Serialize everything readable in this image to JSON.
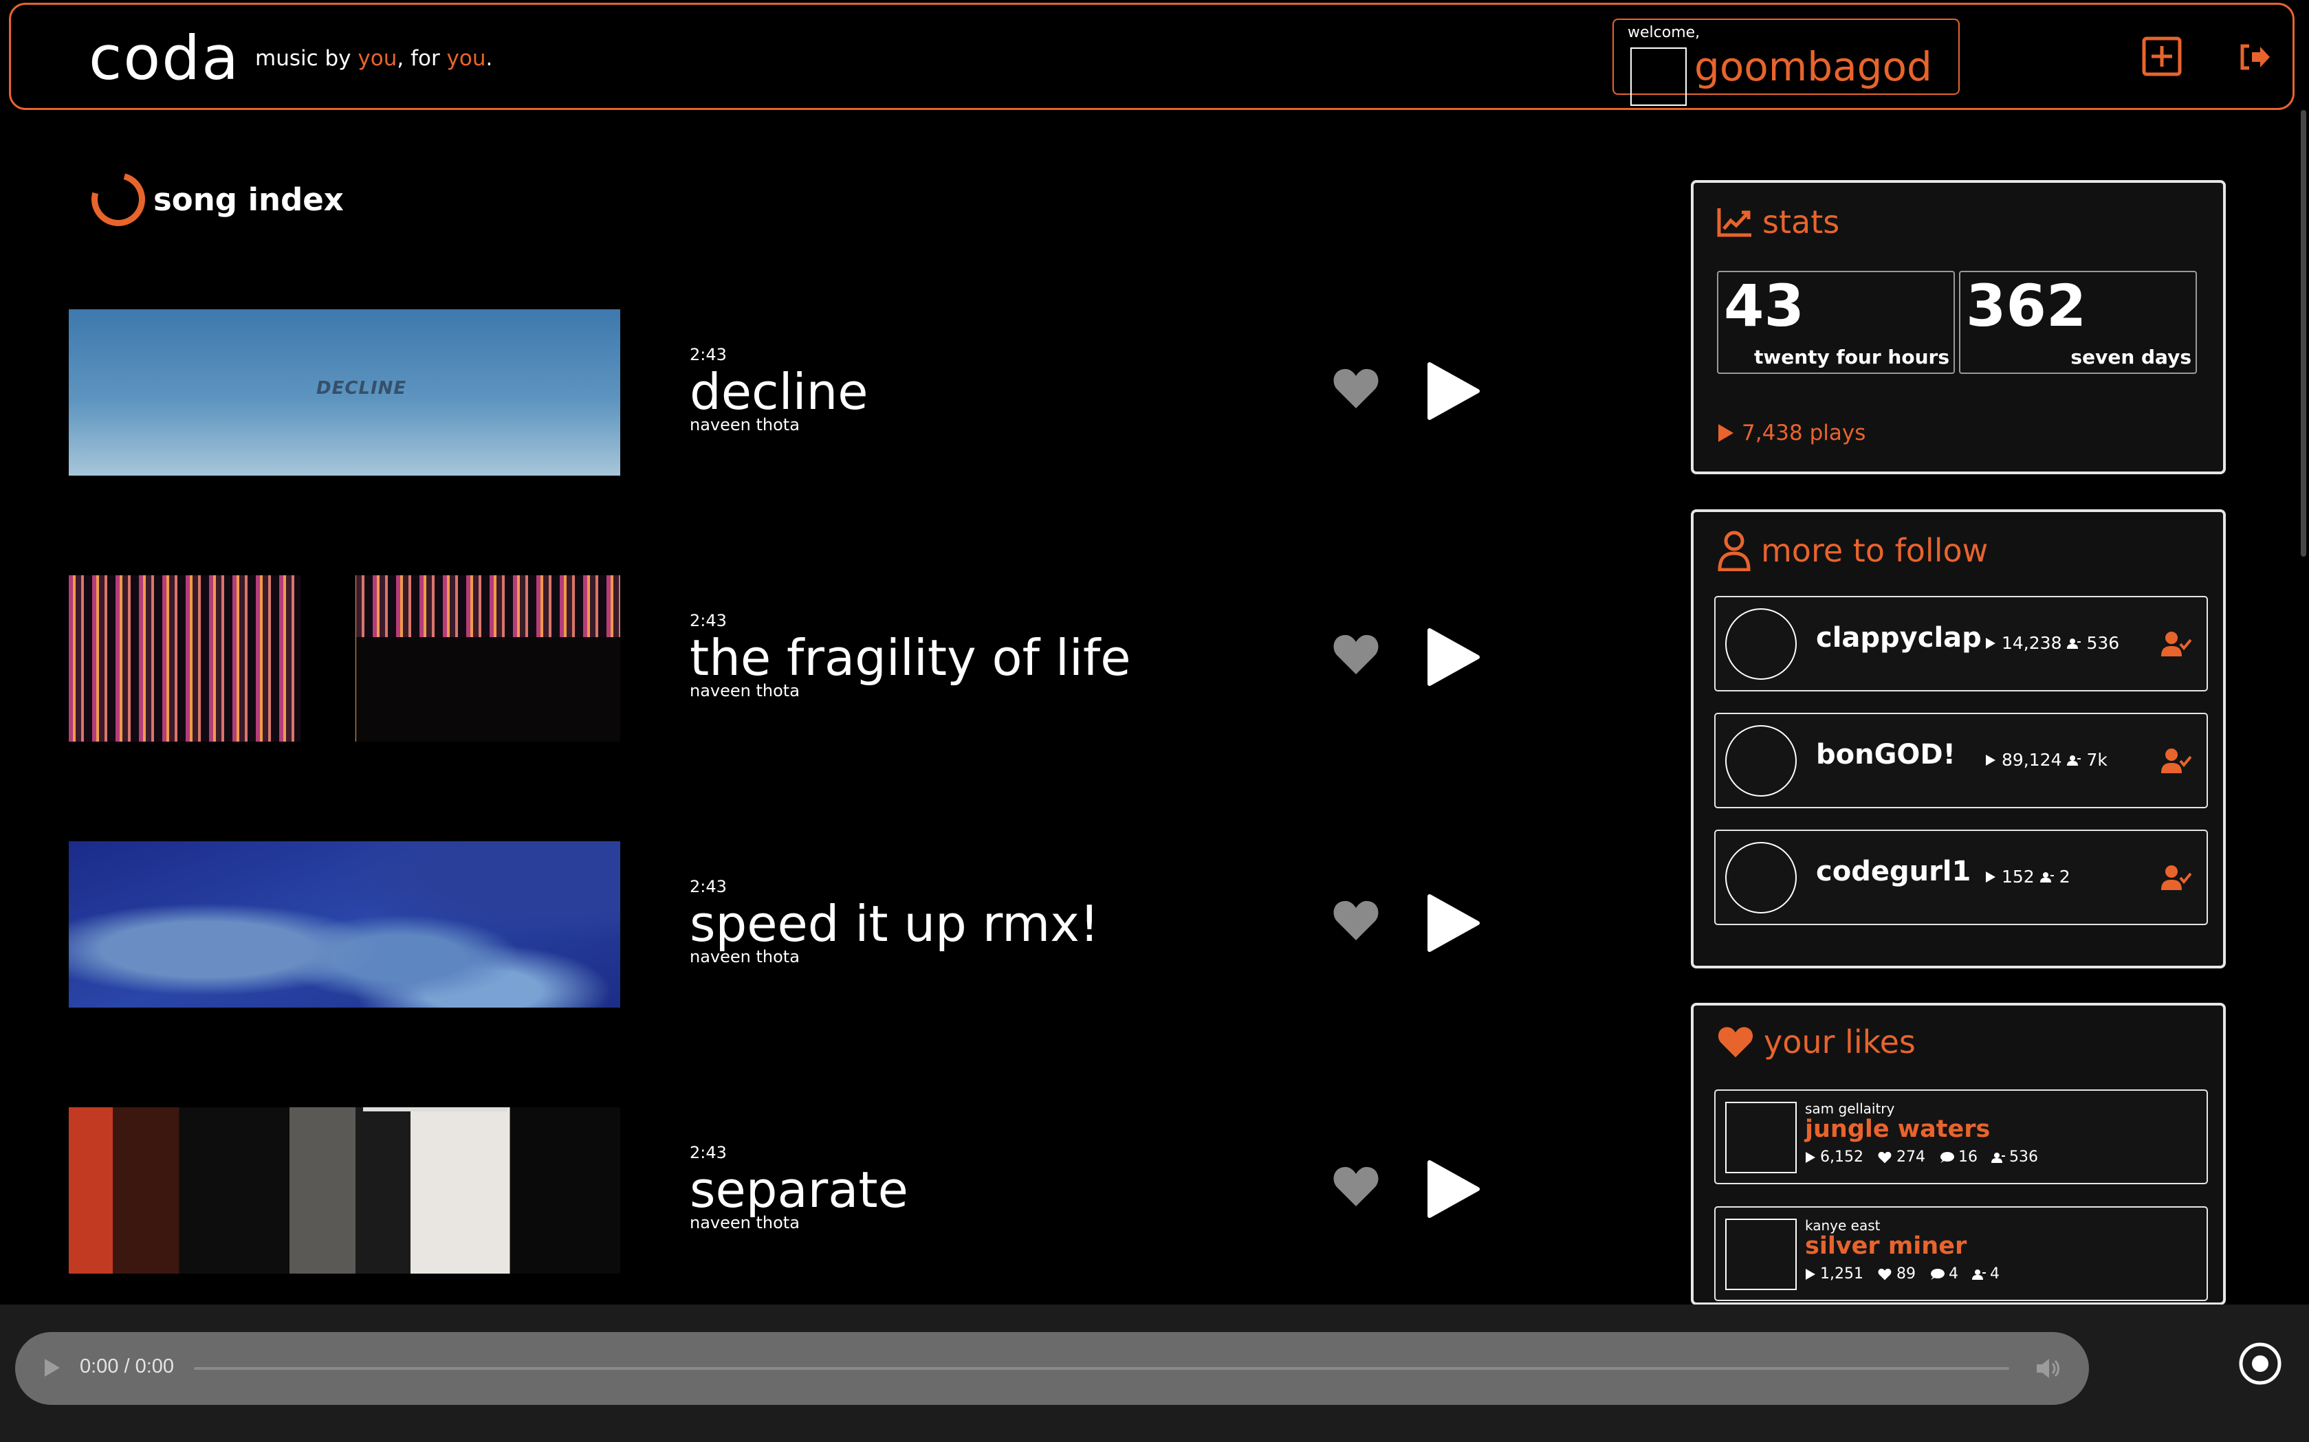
{
  "header": {
    "logo": "coda",
    "tagline_pre": "music by ",
    "tagline_you1": "you",
    "tagline_mid": ", for ",
    "tagline_you2": "you",
    "tagline_end": ".",
    "welcome_label": "welcome,",
    "username": "goombagod",
    "add_icon": "plus-square-icon",
    "logout_icon": "sign-out-icon"
  },
  "song_index": {
    "title": "song index",
    "songs": [
      {
        "duration": "2:43",
        "title": "decline",
        "artist": "naveen thota",
        "art_text": "DECLINE"
      },
      {
        "duration": "2:43",
        "title": "the fragility of life",
        "artist": "naveen thota"
      },
      {
        "duration": "2:43",
        "title": "speed it up rmx!",
        "artist": "naveen thota"
      },
      {
        "duration": "2:43",
        "title": "separate",
        "artist": "naveen thota"
      }
    ]
  },
  "stats": {
    "title": "stats",
    "day_count": "43",
    "day_label": "twenty four hours",
    "week_count": "362",
    "week_label": "seven days",
    "plays": "7,438 plays"
  },
  "follow": {
    "title": "more to follow",
    "users": [
      {
        "name": "clappyclap",
        "plays": "14,238",
        "followers": "536"
      },
      {
        "name": "bonGOD!",
        "plays": "89,124",
        "followers": "7k"
      },
      {
        "name": "codegurl1",
        "plays": "152",
        "followers": "2"
      }
    ]
  },
  "likes": {
    "title": "your likes",
    "items": [
      {
        "artist": "sam gellaitry",
        "title": "jungle waters",
        "plays": "6,152",
        "likes": "274",
        "comments": "16",
        "followers": "536"
      },
      {
        "artist": "kanye east",
        "title": "silver miner",
        "plays": "1,251",
        "likes": "89",
        "comments": "4",
        "followers": "4"
      }
    ]
  },
  "player": {
    "time": "0:00 / 0:00"
  },
  "colors": {
    "accent": "#e8642d",
    "background": "#000000",
    "panel": "#111111",
    "heart_inactive": "#8a8a8a"
  }
}
